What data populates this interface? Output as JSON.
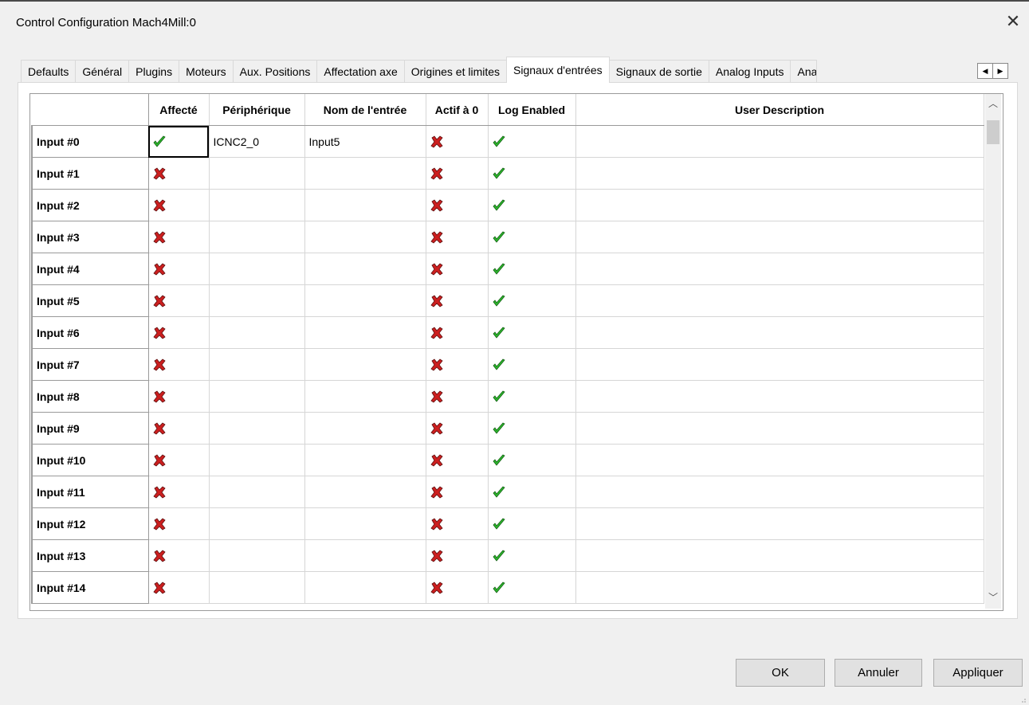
{
  "window": {
    "title": "Control Configuration Mach4Mill:0",
    "close_label": "✕"
  },
  "tabs": [
    {
      "label": "Defaults"
    },
    {
      "label": "Général"
    },
    {
      "label": "Plugins"
    },
    {
      "label": "Moteurs"
    },
    {
      "label": "Aux. Positions"
    },
    {
      "label": "Affectation axe"
    },
    {
      "label": "Origines et limites"
    },
    {
      "label": "Signaux d'entrées",
      "active": true
    },
    {
      "label": "Signaux de sortie"
    },
    {
      "label": "Analog Inputs"
    },
    {
      "label": "Anal"
    }
  ],
  "tab_scroll": {
    "left": "◀",
    "right": "▶"
  },
  "grid": {
    "columns": [
      "Affecté",
      "Périphérique",
      "Nom de l'entrée",
      "Actif à 0",
      "Log Enabled",
      "User Description"
    ],
    "rows": [
      {
        "label": "Input #0",
        "affecte": true,
        "peripherique": "ICNC2_0",
        "nom": "Input5",
        "actif0": false,
        "log": true,
        "desc": ""
      },
      {
        "label": "Input #1",
        "affecte": false,
        "peripherique": "",
        "nom": "",
        "actif0": false,
        "log": true,
        "desc": ""
      },
      {
        "label": "Input #2",
        "affecte": false,
        "peripherique": "",
        "nom": "",
        "actif0": false,
        "log": true,
        "desc": ""
      },
      {
        "label": "Input #3",
        "affecte": false,
        "peripherique": "",
        "nom": "",
        "actif0": false,
        "log": true,
        "desc": ""
      },
      {
        "label": "Input #4",
        "affecte": false,
        "peripherique": "",
        "nom": "",
        "actif0": false,
        "log": true,
        "desc": ""
      },
      {
        "label": "Input #5",
        "affecte": false,
        "peripherique": "",
        "nom": "",
        "actif0": false,
        "log": true,
        "desc": ""
      },
      {
        "label": "Input #6",
        "affecte": false,
        "peripherique": "",
        "nom": "",
        "actif0": false,
        "log": true,
        "desc": ""
      },
      {
        "label": "Input #7",
        "affecte": false,
        "peripherique": "",
        "nom": "",
        "actif0": false,
        "log": true,
        "desc": ""
      },
      {
        "label": "Input #8",
        "affecte": false,
        "peripherique": "",
        "nom": "",
        "actif0": false,
        "log": true,
        "desc": ""
      },
      {
        "label": "Input #9",
        "affecte": false,
        "peripherique": "",
        "nom": "",
        "actif0": false,
        "log": true,
        "desc": ""
      },
      {
        "label": "Input #10",
        "affecte": false,
        "peripherique": "",
        "nom": "",
        "actif0": false,
        "log": true,
        "desc": ""
      },
      {
        "label": "Input #11",
        "affecte": false,
        "peripherique": "",
        "nom": "",
        "actif0": false,
        "log": true,
        "desc": ""
      },
      {
        "label": "Input #12",
        "affecte": false,
        "peripherique": "",
        "nom": "",
        "actif0": false,
        "log": true,
        "desc": ""
      },
      {
        "label": "Input #13",
        "affecte": false,
        "peripherique": "",
        "nom": "",
        "actif0": false,
        "log": true,
        "desc": ""
      },
      {
        "label": "Input #14",
        "affecte": false,
        "peripherique": "",
        "nom": "",
        "actif0": false,
        "log": true,
        "desc": ""
      }
    ]
  },
  "buttons": {
    "ok": "OK",
    "cancel": "Annuler",
    "apply": "Appliquer"
  },
  "icons": {
    "true": "check-icon",
    "false": "cross-icon"
  },
  "colors": {
    "check": "#2db82d",
    "cross": "#cc1f1f"
  }
}
